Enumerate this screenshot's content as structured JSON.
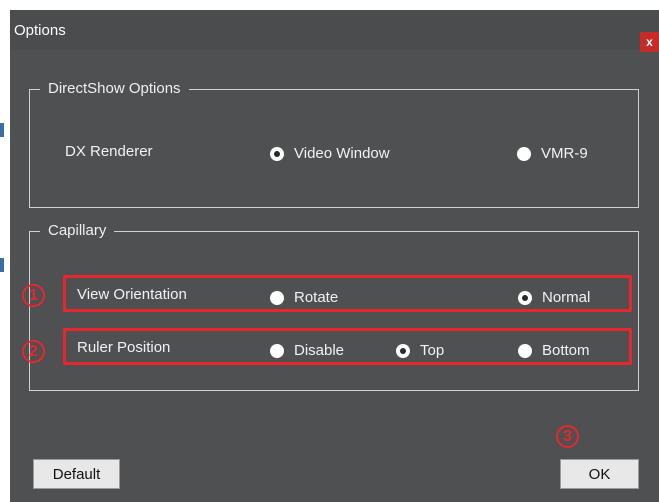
{
  "window": {
    "title": "Options",
    "close_label": "x"
  },
  "directshow": {
    "legend": "DirectShow Options",
    "renderer_label": "DX Renderer",
    "options": [
      {
        "label": "Video Window",
        "selected": true
      },
      {
        "label": "VMR-9",
        "selected": false
      }
    ]
  },
  "capillary": {
    "legend": "Capillary",
    "view_orientation": {
      "label": "View Orientation",
      "options": [
        {
          "label": "Rotate",
          "selected": false
        },
        {
          "label": "Normal",
          "selected": true
        }
      ]
    },
    "ruler_position": {
      "label": "Ruler Position",
      "options": [
        {
          "label": "Disable",
          "selected": false
        },
        {
          "label": "Top",
          "selected": true
        },
        {
          "label": "Bottom",
          "selected": false
        }
      ]
    }
  },
  "callouts": [
    "1",
    "2",
    "3"
  ],
  "buttons": {
    "default_label": "Default",
    "ok_label": "OK"
  },
  "colors": {
    "dialog_bg": "#4e5051",
    "callout": "#e8262d",
    "close": "#c42b2b"
  }
}
